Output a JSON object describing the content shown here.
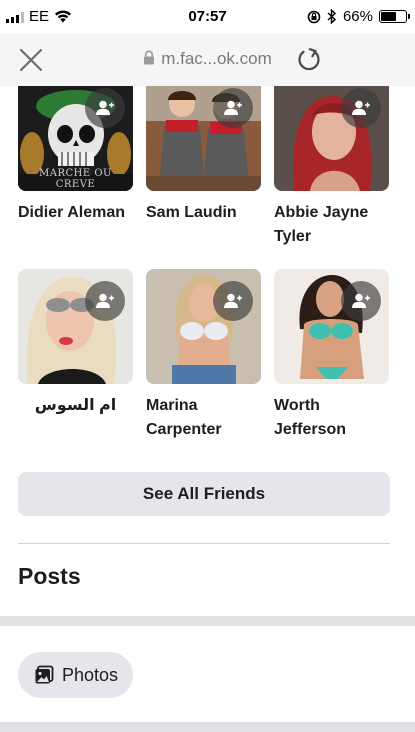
{
  "status_bar": {
    "carrier": "EE",
    "time": "07:57",
    "battery_percent": "66%",
    "battery_level": 0.66
  },
  "browser": {
    "url": "m.fac...ok.com"
  },
  "friends": [
    {
      "name": "Didier Aleman",
      "photo_caption": "MARCHE OU CREVE"
    },
    {
      "name": "Sam Laudin"
    },
    {
      "name": "Abbie Jayne Tyler"
    },
    {
      "name": "ام السوس"
    },
    {
      "name": "Marina Carpenter"
    },
    {
      "name": "Worth Jefferson"
    }
  ],
  "see_all_label": "See All Friends",
  "posts_title": "Posts",
  "photos_label": "Photos"
}
